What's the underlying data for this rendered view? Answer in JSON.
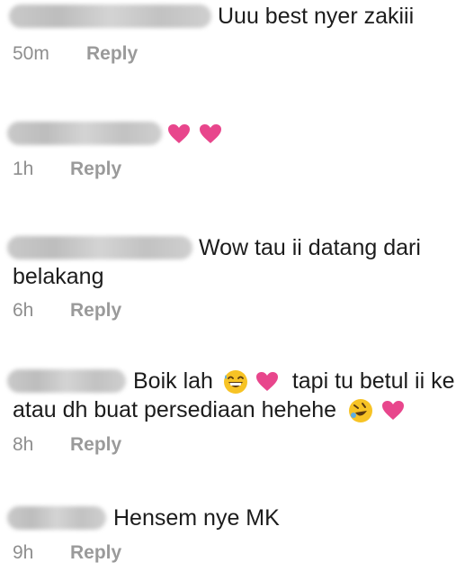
{
  "colors": {
    "text": "#1c1c1c",
    "meta": "#8e8e8e",
    "heart": "#e8468c",
    "emoji": "#f7c325"
  },
  "comments": [
    {
      "text": "Uuu best nyer zakiii",
      "time": "50m",
      "reply_label": "Reply"
    },
    {
      "text": "",
      "emojis": [
        "heart",
        "heart"
      ],
      "time": "1h",
      "reply_label": "Reply"
    },
    {
      "text_line1": "Wow tau ii datang dari",
      "text_line2": "belakang",
      "time": "6h",
      "reply_label": "Reply"
    },
    {
      "text_part1": "Boik lah",
      "text_part2": "tapi tu betul ii ke",
      "text_line2": "atau dh buat persediaan hehehe",
      "emojis": [
        "grinning-sweat",
        "heart",
        "rolling-laughing",
        "heart"
      ],
      "time": "8h",
      "reply_label": "Reply"
    },
    {
      "text": "Hensem nye MK",
      "time": "9h",
      "reply_label": "Reply"
    }
  ]
}
